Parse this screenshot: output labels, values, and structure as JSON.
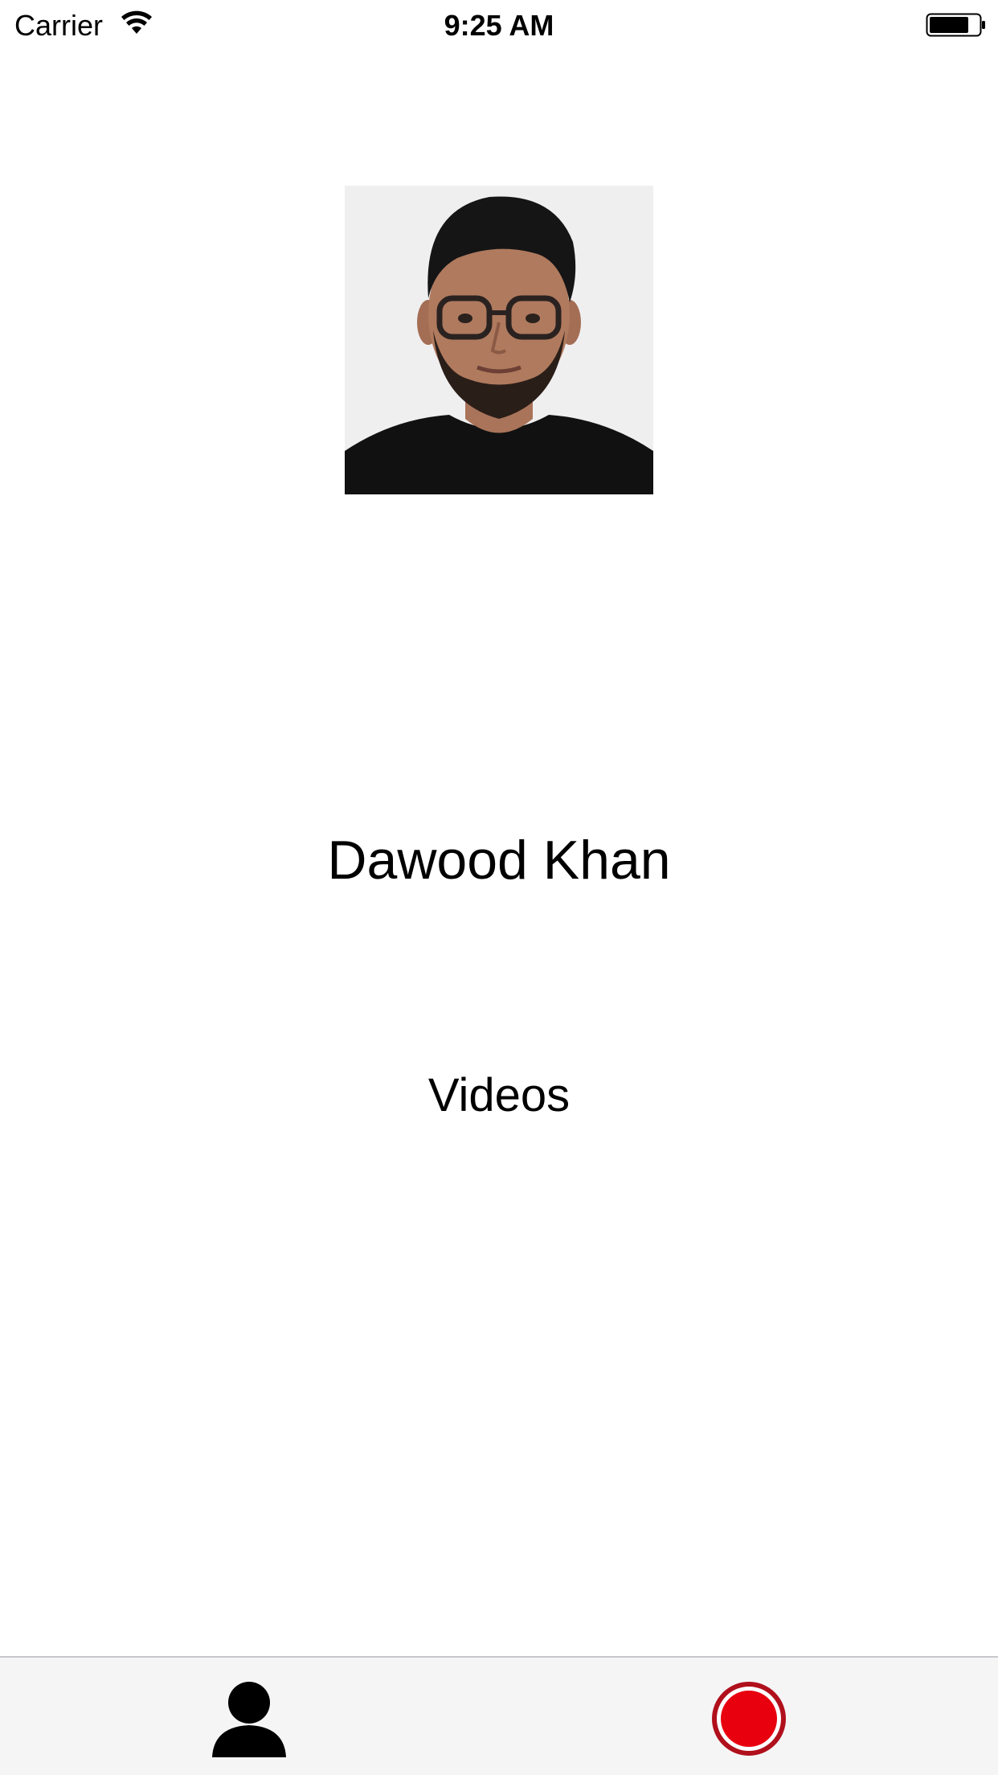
{
  "status_bar": {
    "carrier": "Carrier",
    "time": "9:25 AM",
    "wifi_icon": "wifi-icon",
    "battery_icon": "battery-icon"
  },
  "profile": {
    "avatar": "avatar-photo",
    "name": "Dawood Khan",
    "videos_label": "Videos"
  },
  "tab_bar": {
    "items": [
      {
        "icon": "person-icon"
      },
      {
        "icon": "record-icon"
      }
    ]
  },
  "colors": {
    "record_red": "#e8000f",
    "record_ring": "#b0101c",
    "tab_bar_bg": "#f5f5f6"
  }
}
